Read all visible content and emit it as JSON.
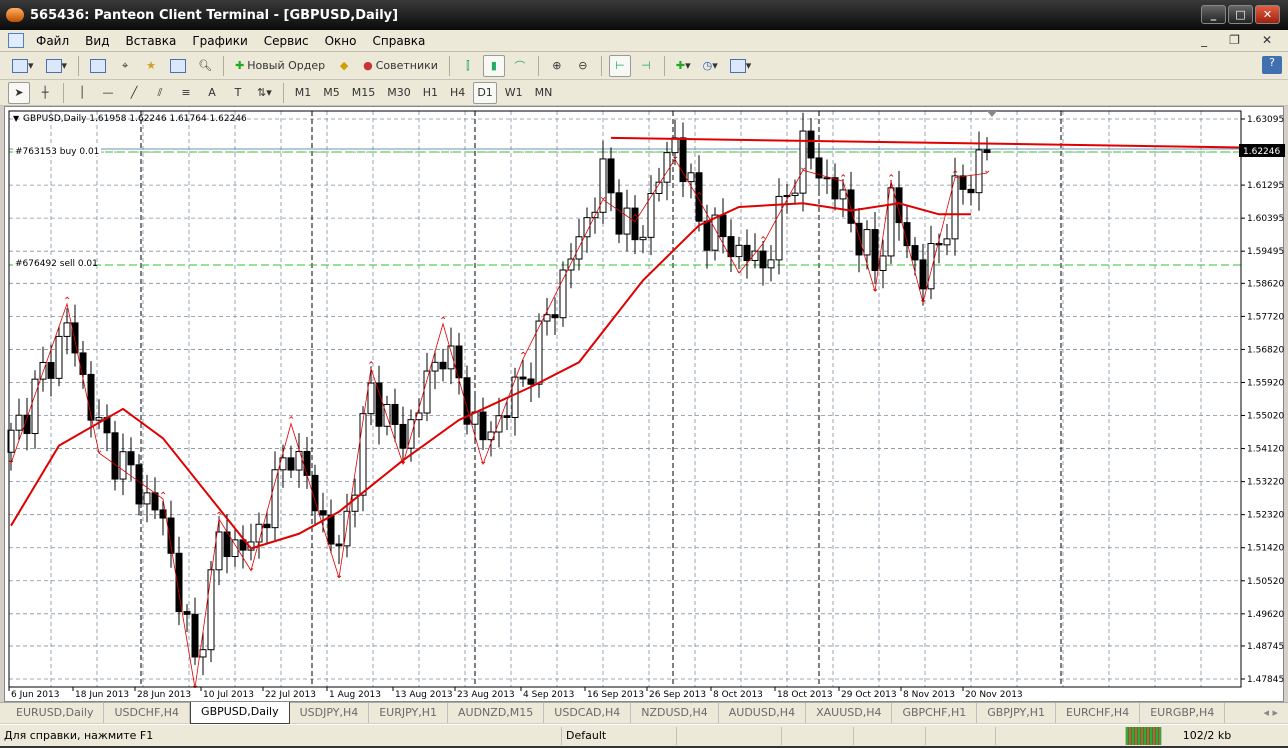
{
  "window": {
    "title": "565436: Panteon Client Terminal - [GBPUSD,Daily]"
  },
  "menu": [
    "Файл",
    "Вид",
    "Вставка",
    "Графики",
    "Сервис",
    "Окно",
    "Справка"
  ],
  "toolbar": {
    "new_order": "Новый Ордер",
    "advisors": "Советники"
  },
  "timeframes": [
    "M1",
    "M5",
    "M15",
    "M30",
    "H1",
    "H4",
    "D1",
    "W1",
    "MN"
  ],
  "active_timeframe": "D1",
  "chart": {
    "header": "GBPUSD,Daily  1.61958 1.62246 1.61764 1.62246",
    "buy_order": "#763153 buy 0.01",
    "sell_order": "#676492 sell 0.01",
    "current_price": "1.62246",
    "price_ticks": [
      "1.63095",
      "1.62195",
      "1.61295",
      "1.60395",
      "1.59495",
      "1.58620",
      "1.57720",
      "1.56820",
      "1.55920",
      "1.55020",
      "1.54120",
      "1.53220",
      "1.52320",
      "1.51420",
      "1.50520",
      "1.49620",
      "1.48745",
      "1.47845"
    ],
    "date_ticks": [
      "6 Jun 2013",
      "18 Jun 2013",
      "28 Jun 2013",
      "10 Jul 2013",
      "22 Jul 2013",
      "1 Aug 2013",
      "13 Aug 2013",
      "23 Aug 2013",
      "4 Sep 2013",
      "16 Sep 2013",
      "26 Sep 2013",
      "8 Oct 2013",
      "18 Oct 2013",
      "29 Oct 2013",
      "8 Nov 2013",
      "20 Nov 2013"
    ],
    "colors": {
      "bull": "#ffffff",
      "bear": "#000000",
      "ma": "#e00000",
      "zigzag": "#e00000",
      "order": "#30c030",
      "grid": "#8090a0"
    }
  },
  "chart_data": {
    "type": "candlestick",
    "symbol": "GBPUSD",
    "timeframe": "Daily",
    "ylim": [
      1.47845,
      1.63095
    ],
    "close_keypoints": [
      [
        0,
        1.5432
      ],
      [
        7,
        1.5746
      ],
      [
        11,
        1.546
      ],
      [
        19,
        1.5215
      ],
      [
        23,
        1.482
      ],
      [
        26,
        1.516
      ],
      [
        30,
        1.514
      ],
      [
        35,
        1.542
      ],
      [
        41,
        1.512
      ],
      [
        45,
        1.557
      ],
      [
        49,
        1.543
      ],
      [
        54,
        1.5692
      ],
      [
        59,
        1.543
      ],
      [
        64,
        1.5596
      ],
      [
        74,
        1.615
      ],
      [
        78,
        1.597
      ],
      [
        83,
        1.626
      ],
      [
        86,
        1.603
      ],
      [
        91,
        1.595
      ],
      [
        94,
        1.591
      ],
      [
        99,
        1.623
      ],
      [
        104,
        1.608
      ],
      [
        108,
        1.59
      ],
      [
        110,
        1.608
      ],
      [
        114,
        1.587
      ],
      [
        118,
        1.609
      ],
      [
        122,
        1.6222
      ]
    ],
    "ma_keypoints": [
      [
        0,
        1.5202
      ],
      [
        6,
        1.542
      ],
      [
        14,
        1.552
      ],
      [
        19,
        1.544
      ],
      [
        30,
        1.514
      ],
      [
        36,
        1.518
      ],
      [
        41,
        1.524
      ],
      [
        49,
        1.538
      ],
      [
        56,
        1.549
      ],
      [
        65,
        1.558
      ],
      [
        71,
        1.5647
      ],
      [
        79,
        1.587
      ],
      [
        86,
        1.602
      ],
      [
        91,
        1.607
      ],
      [
        99,
        1.608
      ],
      [
        105,
        1.606
      ],
      [
        111,
        1.608
      ],
      [
        116,
        1.605
      ],
      [
        120,
        1.605
      ]
    ],
    "resistance_line": [
      [
        75,
        1.6258
      ],
      [
        154,
        1.6232
      ]
    ],
    "buy_level": 1.62195,
    "sell_level": 1.5912
  },
  "tabs": [
    "EURUSD,Daily",
    "USDCHF,H4",
    "GBPUSD,Daily",
    "USDJPY,H4",
    "EURJPY,H1",
    "AUDNZD,M15",
    "USDCAD,H4",
    "NZDUSD,H4",
    "AUDUSD,H4",
    "XAUUSD,H4",
    "GBPCHF,H1",
    "GBPJPY,H1",
    "EURCHF,H4",
    "EURGBP,H4"
  ],
  "active_tab": "GBPUSD,Daily",
  "status": {
    "help": "Для справки, нажмите F1",
    "profile": "Default",
    "traffic": "102/2 kb"
  }
}
